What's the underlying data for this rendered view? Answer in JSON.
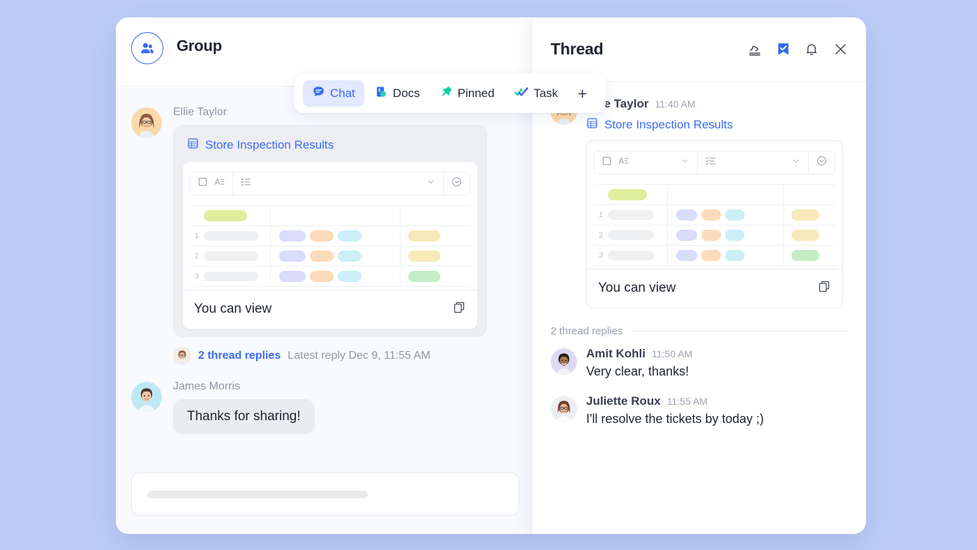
{
  "theme": {
    "page_bg": "#bcccf7",
    "accent": "#3b6cf4",
    "panel_bg": "#f8fafd",
    "thread_bg": "#ffffff",
    "muted_text": "#9096a6"
  },
  "left_panel": {
    "group_icon": "group-people-icon",
    "title": "Group",
    "tabs": [
      {
        "label": "Chat",
        "icon": "chat-bubble-icon",
        "active": true
      },
      {
        "label": "Docs",
        "icon": "docs-icon",
        "active": false
      },
      {
        "label": "Pinned",
        "icon": "pin-icon",
        "active": false
      },
      {
        "label": "Task",
        "icon": "check-task-icon",
        "active": false
      }
    ],
    "add_tab_label": "+",
    "messages": [
      {
        "author": "Ellie Taylor",
        "attachment": {
          "icon": "spreadsheet-icon",
          "title": "Store Inspection Results",
          "footer_text": "You can view",
          "copy_icon": "copy-icon"
        },
        "thread_summary": {
          "link": "2 thread replies",
          "meta": "Latest reply Dec 9, 11:55 AM"
        }
      },
      {
        "author": "James Morris",
        "text": "Thanks for sharing!"
      }
    ],
    "composer": {
      "placeholder": ""
    }
  },
  "thread_panel": {
    "title": "Thread",
    "actions": [
      {
        "icon": "share-forward-icon",
        "name": "share"
      },
      {
        "icon": "bookmark-check-icon",
        "name": "mark-done",
        "active": true
      },
      {
        "icon": "bell-icon",
        "name": "notifications"
      },
      {
        "icon": "close-icon",
        "name": "close"
      }
    ],
    "root_message": {
      "author": "Ellie Taylor",
      "time": "11:40 AM",
      "attachment": {
        "icon": "spreadsheet-icon",
        "title": "Store Inspection Results",
        "footer_text": "You can view",
        "copy_icon": "copy-icon"
      }
    },
    "replies_header": "2 thread replies",
    "replies": [
      {
        "author": "Amit Kohli",
        "time": "11:50 AM",
        "text": "Very clear, thanks!"
      },
      {
        "author": "Juliette Roux",
        "time": "11:55 AM",
        "text": "I'll resolve the tickets by today ;)"
      }
    ]
  },
  "sheet": {
    "toolbar_icons": [
      "checkbox-icon",
      "text-format-icon",
      "chevron-down-icon",
      "checklist-icon",
      "chevron-down-icon",
      "circle-chevron-down-icon"
    ],
    "header_pill_color": "#dfee9c",
    "rows": [
      {
        "num": "1",
        "tags": [
          "#d9dcfb",
          "#fcdbbb",
          "#cbeff7"
        ],
        "status": "#f7e9b8"
      },
      {
        "num": "2",
        "tags": [
          "#d9dcfb",
          "#fcdbbb",
          "#cbeff7"
        ],
        "status": "#f7e9b8"
      },
      {
        "num": "3",
        "tags": [
          "#d9dcfb",
          "#fcdbbb",
          "#cbeff7"
        ],
        "status": "#c5edc5"
      }
    ]
  }
}
